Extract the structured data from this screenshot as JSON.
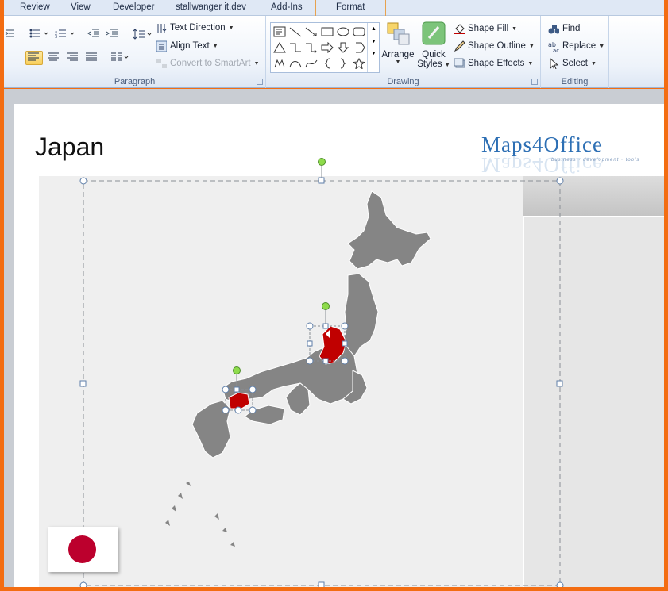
{
  "tabs": [
    "Review",
    "View",
    "Developer",
    "stallwanger it.dev",
    "Add-Ins",
    "Format"
  ],
  "paragraph": {
    "label": "Paragraph",
    "text_direction": "Text Direction",
    "align_text": "Align Text",
    "convert_smartart": "Convert to SmartArt"
  },
  "drawing": {
    "label": "Drawing",
    "arrange": "Arrange",
    "quick_styles_1": "Quick",
    "quick_styles_2": "Styles",
    "shape_fill": "Shape Fill",
    "shape_outline": "Shape Outline",
    "shape_effects": "Shape Effects"
  },
  "editing": {
    "label": "Editing",
    "find": "Find",
    "replace": "Replace",
    "select": "Select"
  },
  "slide": {
    "title": "Japan",
    "logo": "Maps4Office",
    "logo_tagline": "business · development · tools"
  },
  "colors": {
    "map_gray": "#858585",
    "highlight_red": "#c00000",
    "flag_red": "#bc002d",
    "accent_orange": "#f36d12"
  }
}
